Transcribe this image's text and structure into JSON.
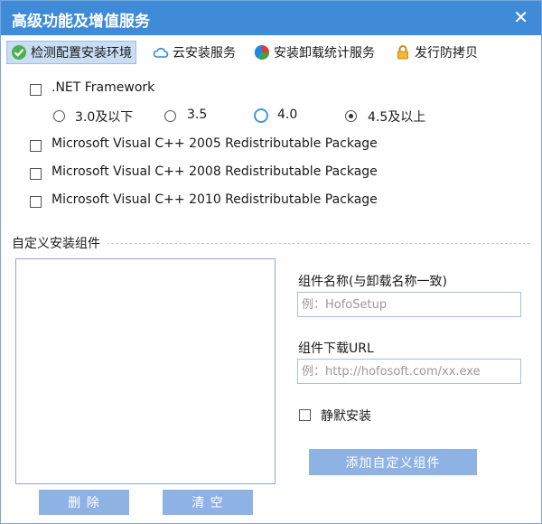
{
  "window": {
    "title": "高级功能及增值服务",
    "close_glyph": "✕"
  },
  "tabs": [
    {
      "label": "检测配置安装环境",
      "icon": "check-circle-icon",
      "active": true
    },
    {
      "label": "云安装服务",
      "icon": "cloud-icon",
      "active": false
    },
    {
      "label": "安装卸载统计服务",
      "icon": "pie-chart-icon",
      "active": false
    },
    {
      "label": "发行防拷贝",
      "icon": "lock-icon",
      "active": false
    }
  ],
  "netframework": {
    "label": ".NET Framework",
    "checked": false,
    "options": [
      "3.0及以下",
      "3.5",
      "4.0",
      "4.5及以上"
    ],
    "selected": "4.5及以上"
  },
  "vcredist": [
    {
      "label": "Microsoft Visual C++ 2005 Redistributable Package",
      "checked": false
    },
    {
      "label": "Microsoft Visual C++ 2008 Redistributable Package",
      "checked": false
    },
    {
      "label": "Microsoft Visual C++ 2010 Redistributable Package",
      "checked": false
    }
  ],
  "custom": {
    "section_title": "自定义安装组件",
    "name_label": "组件名称(与卸载名称一致)",
    "name_placeholder": "例：HofoSetup",
    "url_label": "组件下载URL",
    "url_placeholder": "例：http://hofosoft.com/xx.exe",
    "silent_label": "静默安装",
    "silent_checked": false,
    "add_button": "添加自定义组件",
    "delete_button": "删 除",
    "clear_button": "清 空"
  },
  "colors": {
    "titlebar": "#3f8bd8",
    "button": "#8fb2e4",
    "tab_active": "#c9ddf3"
  }
}
